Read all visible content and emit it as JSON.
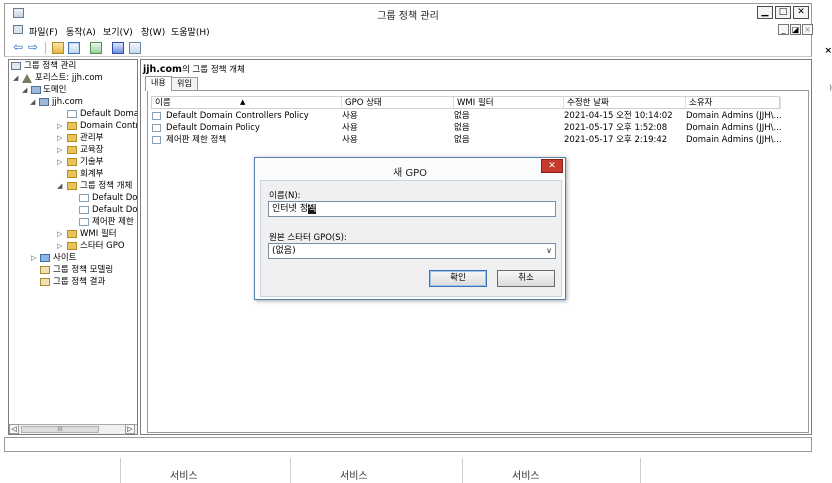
{
  "window": {
    "title": "그룹 정책 관리",
    "controls": {
      "minimize": "▁",
      "restore": "□",
      "close": "✕"
    }
  },
  "menu": {
    "items": [
      "파일(F)",
      "동작(A)",
      "보기(V)",
      "창(W)",
      "도움말(H)"
    ],
    "mdi": {
      "minimize": "_",
      "restore": "◪",
      "close": "×"
    }
  },
  "toolbar": {
    "back": "⇦",
    "forward": "⇨"
  },
  "tree": {
    "root": "그룹 정책 관리",
    "forest": "포리스트: jjh.com",
    "domains": "도메인",
    "domain": "jjh.com",
    "items": [
      "Default Domair",
      "Domain Contro",
      "관리부",
      "교육장",
      "기술부",
      "회계부"
    ],
    "gpo_container": "그룹 정책 개체",
    "gpos": [
      "Default Dom",
      "Default Dom",
      "제어판 제한"
    ],
    "wmi": "WMI 필터",
    "starter": "스타터 GPO",
    "sites": "사이트",
    "modeling": "그룹 정책 모델링",
    "results": "그룹 정책 결과",
    "scroll_thumb": "III"
  },
  "content": {
    "title": "jjh.com",
    "title_suffix": "의 그룹 정책 개체",
    "tabs": [
      "내용",
      "위임"
    ],
    "columns": [
      "이름",
      "GPO 상태",
      "WMI 필터",
      "수정한 날짜",
      "소유자"
    ],
    "sort_indicator": "▲",
    "rows": [
      {
        "name": "Default Domain Controllers Policy",
        "status": "사용",
        "wmi": "없음",
        "modified": "2021-04-15 오전 10:14:02",
        "owner": "Domain Admins (JJH\\..."
      },
      {
        "name": "Default Domain Policy",
        "status": "사용",
        "wmi": "없음",
        "modified": "2021-05-17 오후 1:52:08",
        "owner": "Domain Admins (JJH\\..."
      },
      {
        "name": "제어판 제한 정책",
        "status": "사용",
        "wmi": "없음",
        "modified": "2021-05-17 오후 2:19:42",
        "owner": "Domain Admins (JJH\\..."
      }
    ]
  },
  "dialog": {
    "title": "새 GPO",
    "close": "✕",
    "name_label": "이름(N):",
    "name_value": "인터넷 정",
    "name_ime": "책",
    "starter_label": "원본 스타터 GPO(S):",
    "starter_value": "(없음)",
    "caret": "∨",
    "ok": "확인",
    "cancel": "취소"
  },
  "bottom": {
    "labels": [
      "서비스",
      "서비스",
      "서비스"
    ]
  },
  "edge": {
    "fragment_a": "×",
    "fragment_b": ")"
  }
}
